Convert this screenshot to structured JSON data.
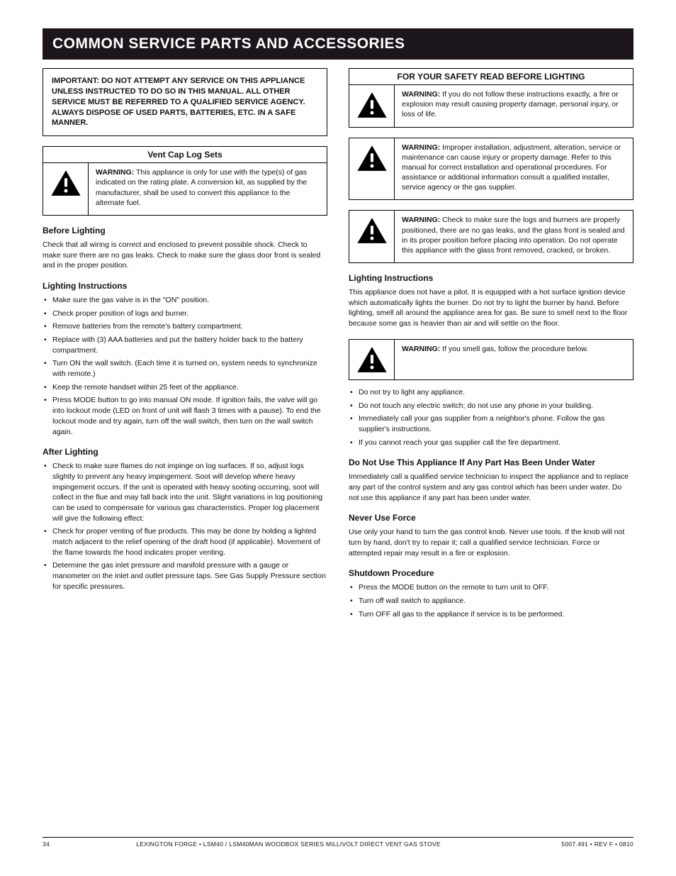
{
  "header": {
    "title": "COMMON SERVICE PARTS AND ACCESSORIES"
  },
  "left": {
    "introBox": "IMPORTANT: DO NOT ATTEMPT ANY SERVICE ON THIS APPLIANCE UNLESS INSTRUCTED TO DO SO IN THIS MANUAL. ALL OTHER SERVICE MUST BE REFERRED TO A QUALIFIED SERVICE AGENCY. ALWAYS DISPOSE OF USED PARTS, BATTERIES, ETC. IN A SAFE MANNER.",
    "ventCapSection": "Vent Cap Log Sets",
    "ventCapWarning": {
      "label": "WARNING:",
      "text": "This appliance is only for use with the type(s) of gas indicated on the rating plate. A conversion kit, as supplied by the manufacturer, shall be used to convert this appliance to the alternate fuel."
    },
    "heading1": "Before Lighting",
    "para1": "Check that all wiring is correct and enclosed to prevent possible shock. Check to make sure there are no gas leaks. Check to make sure the glass door front is sealed and in the proper position.",
    "heading2": "Lighting Instructions",
    "lightSteps": [
      "Make sure the gas valve is in the \"ON\" position.",
      "Check proper position of logs and burner.",
      "Remove batteries from the remote's battery compartment.",
      "Replace with (3) AAA batteries and put the battery holder back to the battery compartment.",
      "Turn ON the wall switch. (Each time it is turned on, system needs to synchronize with remote.)",
      "Keep the remote handset within 25 feet of the appliance.",
      "Press MODE button to go into manual ON mode. If ignition fails, the valve will go into lockout mode (LED on front of unit will flash 3 times with a pause). To end the lockout mode and try again, turn off the wall switch, then turn on the wall switch again."
    ],
    "heading3": "After Lighting",
    "afterSteps": [
      "Check to make sure flames do not impinge on log surfaces. If so, adjust logs slightly to prevent any heavy impingement. Soot will develop where heavy impingement occurs. If the unit is operated with heavy sooting occurring, soot will collect in the flue and may fall back into the unit. Slight variations in log positioning can be used to compensate for various gas characteristics. Proper log placement will give the following effect:",
      "Check for proper venting of flue products. This may be done by holding a lighted match adjacent to the relief opening of the draft hood (if applicable). Movement of the flame towards the hood indicates proper venting.",
      "Determine the gas inlet pressure and manifold pressure with a gauge or manometer on the inlet and outlet pressure taps. See Gas Supply Pressure section for specific pressures."
    ]
  },
  "right": {
    "forYourSafety": "FOR YOUR SAFETY READ BEFORE LIGHTING",
    "warnA": {
      "label": "WARNING:",
      "text": "If you do not follow these instructions exactly, a fire or explosion may result causing property damage, personal injury, or loss of life."
    },
    "warnB": {
      "label": "WARNING:",
      "text": "Improper installation, adjustment, alteration, service or maintenance can cause injury or property damage. Refer to this manual for correct installation and operational procedures. For assistance or additional information consult a qualified installer, service agency or the gas supplier."
    },
    "warnC": {
      "label": "WARNING:",
      "text": "Check to make sure the logs and burners are properly positioned, there are no gas leaks, and the glass front is sealed and in its proper position before placing into operation. Do not operate this appliance with the glass front removed, cracked, or broken."
    },
    "heading1": "Lighting Instructions",
    "para1": "This appliance does not have a pilot. It is equipped with a hot surface ignition device which automatically lights the burner. Do not try to light the burner by hand. Before lighting, smell all around the appliance area for gas. Be sure to smell next to the floor because some gas is heavier than air and will settle on the floor.",
    "warnD": {
      "label": "WARNING:",
      "text": "If you smell gas, follow the procedure below."
    },
    "smellBullets": [
      "Do not try to light any appliance.",
      "Do not touch any electric switch; do not use any phone in your building.",
      "Immediately call your gas supplier from a neighbor's phone. Follow the gas supplier's instructions.",
      "If you cannot reach your gas supplier call the fire department."
    ],
    "dontUseHeading": "Do Not Use This Appliance If Any Part Has Been Under Water",
    "dontUsePara": "Immediately call a qualified service technician to inspect the appliance and to replace any part of the control system and any gas control which has been under water. Do not use this appliance if any part has been under water.",
    "forceHeading": "Never Use Force",
    "forcePara": "Use only your hand to turn the gas control knob. Never use tools. If the knob will not turn by hand, don't try to repair it; call a qualified service technician. Force or attempted repair may result in a fire or explosion.",
    "shutdownHeading": "Shutdown Procedure",
    "shutdownSteps": [
      "Press the MODE button on the remote to turn unit to OFF.",
      "Turn off wall switch to appliance.",
      "Turn OFF all gas to the appliance if service is to be performed."
    ]
  },
  "footer": {
    "page": "34",
    "mid": "LEXINGTON FORGE   •   LSM40 / LSM40MAN WOODBOX SERIES MILLIVOLT DIRECT VENT GAS STOVE",
    "rev": "5007.491   •   REV F   •   0810"
  }
}
